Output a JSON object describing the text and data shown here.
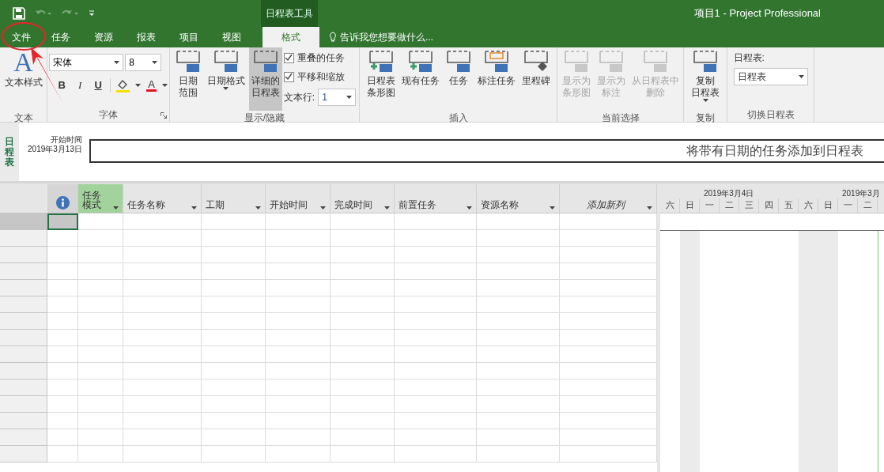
{
  "window": {
    "title": "项目1 - Project Professional",
    "context_tab_group": "日程表工具"
  },
  "tabs": [
    {
      "label": "文件",
      "selected": false
    },
    {
      "label": "任务",
      "selected": false
    },
    {
      "label": "资源",
      "selected": false
    },
    {
      "label": "报表",
      "selected": false
    },
    {
      "label": "项目",
      "selected": false
    },
    {
      "label": "视图",
      "selected": false
    },
    {
      "label": "格式",
      "selected": true
    }
  ],
  "tell_me": "告诉我您想要做什么...",
  "ribbon": [
    {
      "label": "文本",
      "items": [
        {
          "kind": "large",
          "lines": [
            "文本样式"
          ],
          "glyph": "A",
          "disabled": false,
          "selected": false
        }
      ]
    },
    {
      "label": "字体",
      "launcher": true,
      "items": [
        {
          "kind": "font",
          "font": "宋体",
          "size": "8",
          "styles": [
            "B",
            "I",
            "U"
          ],
          "color_glyph": "A"
        }
      ]
    },
    {
      "label": "显示/隐藏",
      "items": [
        {
          "kind": "large",
          "lines": [
            "日期",
            "范围"
          ],
          "disabled": false,
          "selected": false
        },
        {
          "kind": "large",
          "lines": [
            "日期格式"
          ],
          "disabled": false,
          "selected": false,
          "caret": true
        },
        {
          "kind": "large",
          "lines": [
            "详细的",
            "日程表"
          ],
          "disabled": false,
          "selected": true
        },
        {
          "kind": "checks",
          "checks": [
            {
              "label": "重叠的任务",
              "checked": true
            },
            {
              "label": "平移和缩放",
              "checked": true
            }
          ],
          "lines_label": "文本行:",
          "lines_value": "1"
        }
      ]
    },
    {
      "label": "插入",
      "items": [
        {
          "kind": "large",
          "lines": [
            "日程表",
            "条形图"
          ],
          "disabled": false,
          "selected": false
        },
        {
          "kind": "large",
          "lines": [
            "现有任务"
          ],
          "disabled": false,
          "selected": false
        },
        {
          "kind": "large",
          "lines": [
            "任务"
          ],
          "disabled": false,
          "selected": false
        },
        {
          "kind": "large",
          "lines": [
            "标注任务"
          ],
          "disabled": false,
          "selected": false
        },
        {
          "kind": "large",
          "lines": [
            "里程碑"
          ],
          "disabled": false,
          "selected": false
        }
      ]
    },
    {
      "label": "当前选择",
      "items": [
        {
          "kind": "large",
          "lines": [
            "显示为",
            "条形图"
          ],
          "disabled": true,
          "selected": false
        },
        {
          "kind": "large",
          "lines": [
            "显示为",
            "标注"
          ],
          "disabled": true,
          "selected": false
        },
        {
          "kind": "large",
          "lines": [
            "从日程表中",
            "删除"
          ],
          "disabled": true,
          "selected": false
        }
      ]
    },
    {
      "label": "复制",
      "items": [
        {
          "kind": "large",
          "lines": [
            "复制",
            "日程表"
          ],
          "disabled": false,
          "selected": false,
          "caret": true
        }
      ]
    },
    {
      "label": "切换日程表",
      "items": [
        {
          "kind": "select",
          "label": "日程表:",
          "value": "日程表"
        }
      ]
    }
  ],
  "timeline": {
    "title": "日程表",
    "start_label": "开始时间",
    "start_date": "2019年3月13日",
    "placeholder": "将带有日期的任务添加到日程表"
  },
  "table": {
    "columns": [
      {
        "kind": "info",
        "selected": false
      },
      {
        "kind": "field",
        "lines": [
          "任务",
          "模式"
        ],
        "selected": true
      },
      {
        "kind": "field",
        "lines": [
          "任务名称"
        ],
        "selected": false
      },
      {
        "kind": "field",
        "lines": [
          "工期"
        ],
        "selected": false
      },
      {
        "kind": "field",
        "lines": [
          "开始时间"
        ],
        "selected": false
      },
      {
        "kind": "field",
        "lines": [
          "完成时间"
        ],
        "selected": false
      },
      {
        "kind": "field",
        "lines": [
          "前置任务"
        ],
        "selected": false
      },
      {
        "kind": "field",
        "lines": [
          "资源名称"
        ],
        "selected": false
      },
      {
        "kind": "add",
        "lines": [
          "添加新列"
        ],
        "selected": false
      }
    ],
    "rows": [
      {
        "selected": true
      }
    ]
  },
  "gantt": {
    "weeks": [
      {
        "label": "2019年3月4日"
      },
      {
        "label": "2019年3月"
      }
    ],
    "days": [
      {
        "label": "六",
        "weekend": false
      },
      {
        "label": "日",
        "weekend": true
      },
      {
        "label": "一",
        "weekend": false
      },
      {
        "label": "二",
        "weekend": false
      },
      {
        "label": "三",
        "weekend": false
      },
      {
        "label": "四",
        "weekend": false
      },
      {
        "label": "五",
        "weekend": false
      },
      {
        "label": "六",
        "weekend": true
      },
      {
        "label": "日",
        "weekend": true
      },
      {
        "label": "一",
        "weekend": false
      },
      {
        "label": "二",
        "weekend": false
      }
    ]
  }
}
